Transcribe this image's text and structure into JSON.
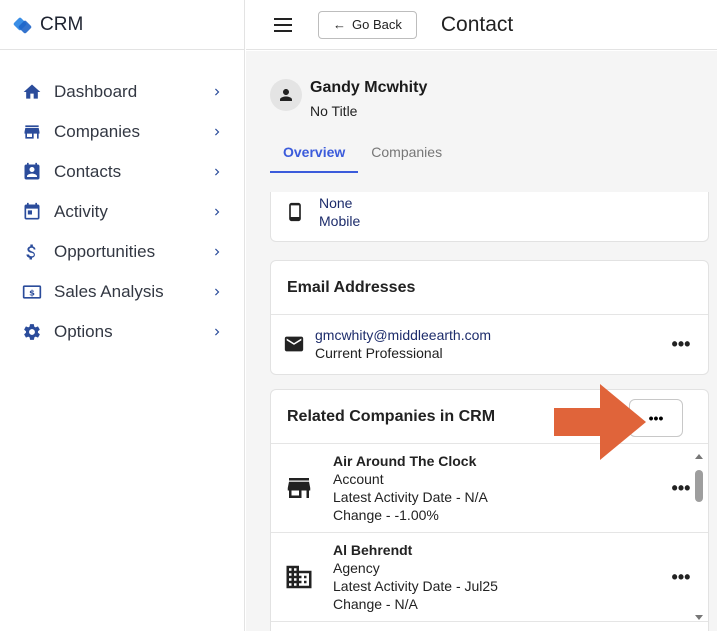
{
  "brand": {
    "name": "CRM"
  },
  "sidebar": {
    "items": [
      {
        "label": "Dashboard",
        "icon": "home-icon"
      },
      {
        "label": "Companies",
        "icon": "store-icon"
      },
      {
        "label": "Contacts",
        "icon": "contact-card-icon"
      },
      {
        "label": "Activity",
        "icon": "calendar-icon"
      },
      {
        "label": "Opportunities",
        "icon": "dollar-icon"
      },
      {
        "label": "Sales Analysis",
        "icon": "money-icon"
      },
      {
        "label": "Options",
        "icon": "gear-icon"
      }
    ]
  },
  "topbar": {
    "go_back_label": "Go Back",
    "title": "Contact"
  },
  "contact": {
    "name": "Gandy Mcwhity",
    "title": "No Title"
  },
  "tabs": [
    {
      "label": "Overview",
      "active": true
    },
    {
      "label": "Companies",
      "active": false
    }
  ],
  "phone": {
    "number": "None",
    "type": "Mobile"
  },
  "email_section": {
    "heading": "Email Addresses",
    "address": "gmcwhity@middleearth.com",
    "type": "Current Professional",
    "more": "•••"
  },
  "related": {
    "heading": "Related Companies in CRM",
    "more_button": "•••",
    "companies": [
      {
        "name": "Air Around The Clock",
        "type": "Account",
        "activity": "Latest Activity Date - N/A",
        "change": "Change - -1.00%",
        "more": "•••",
        "icon": "store-icon"
      },
      {
        "name": "Al Behrendt",
        "type": "Agency",
        "activity": "Latest Activity Date - Jul25",
        "change": "Change - N/A",
        "more": "•••",
        "icon": "building-icon"
      }
    ]
  },
  "colors": {
    "accent": "#3b5bdb",
    "arrow": "#e0643a",
    "link": "#1d2c6b",
    "icon": "#2b4c9b"
  }
}
